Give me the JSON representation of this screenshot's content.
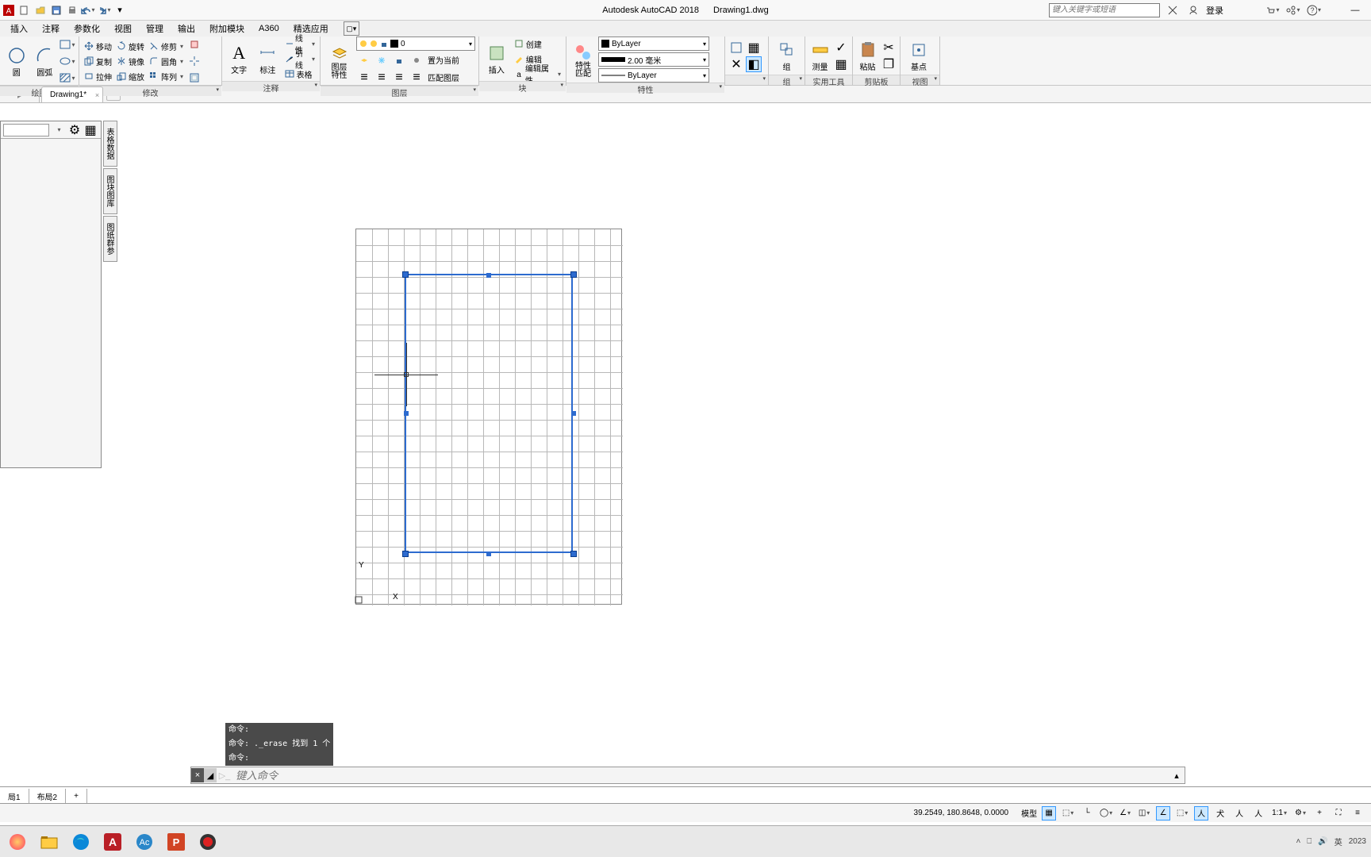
{
  "title": {
    "app": "Autodesk AutoCAD 2018",
    "doc": "Drawing1.dwg"
  },
  "qat": {
    "items": [
      "new",
      "open",
      "save",
      "print",
      "undo",
      "redo"
    ]
  },
  "search": {
    "placeholder": "键入关键字或短语",
    "login": "登录"
  },
  "menu": {
    "items": [
      "插入",
      "注释",
      "参数化",
      "视图",
      "管理",
      "输出",
      "附加模块",
      "A360",
      "精选应用"
    ]
  },
  "ribbon": {
    "draw": {
      "items": [
        "圆",
        "圆弧"
      ],
      "hdr": "绘图"
    },
    "modify": {
      "hdr": "修改",
      "rows": [
        [
          "移动",
          "旋转",
          "修剪"
        ],
        [
          "复制",
          "镜像",
          "圆角"
        ],
        [
          "拉伸",
          "缩放",
          "阵列"
        ]
      ]
    },
    "annot": {
      "hdr": "注释",
      "text": "文字",
      "dim": "标注",
      "table": "表格",
      "row": [
        "线性",
        "引线",
        "表格"
      ]
    },
    "layer": {
      "hdr": "图层",
      "prop": "图层\n特性",
      "combo": "0",
      "set": "置为当前",
      "match": "匹配图层"
    },
    "block": {
      "hdr": "块",
      "insert": "插入",
      "create": "创建",
      "edit": "编辑",
      "attr": "编辑属性"
    },
    "props": {
      "hdr": "特性",
      "match": "特性\n匹配",
      "bylayer": "ByLayer",
      "lw": "2.00 毫米",
      "lt": "ByLayer"
    },
    "group": {
      "hdr": "组",
      "label": "组"
    },
    "util": {
      "hdr": "实用工具",
      "label": "测量"
    },
    "clip": {
      "hdr": "剪贴板",
      "label": "粘贴"
    },
    "base": {
      "hdr": "视图",
      "label": "基点"
    }
  },
  "doctab": {
    "name": "Drawing1*"
  },
  "sidetabs": [
    "表格数据",
    "图块图库",
    "图纸群参"
  ],
  "ucs": {
    "y": "Y",
    "x": "X"
  },
  "cmd": {
    "hist": [
      "命令:",
      "命令: ._erase 找到 1 个",
      "命令:"
    ],
    "placeholder": "键入命令"
  },
  "layout": {
    "tabs": [
      "局1",
      "布局2"
    ]
  },
  "status": {
    "coord": "39.2549, 180.8648, 0.0000",
    "model": "模型",
    "scale": "1:1"
  },
  "tray": {
    "ime": "英",
    "year": "2023"
  }
}
